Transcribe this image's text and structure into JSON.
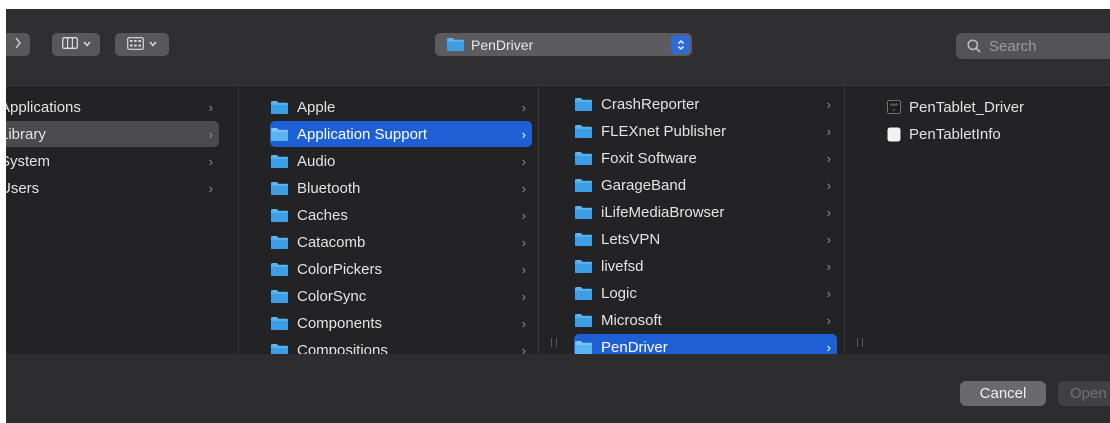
{
  "toolbar": {
    "forward_icon": "chevron-right-icon",
    "view_icon": "column-view-icon",
    "group_icon": "group-grid-icon",
    "path_popup_label": "PenDriver",
    "search_placeholder": "Search"
  },
  "columns": {
    "locations": [
      {
        "label": "Applications",
        "selected": false
      },
      {
        "label": "Library",
        "selected": true
      },
      {
        "label": "System",
        "selected": false
      },
      {
        "label": "Users",
        "selected": false
      }
    ],
    "library": [
      {
        "label": "Apple",
        "selected": false
      },
      {
        "label": "Application Support",
        "selected": true
      },
      {
        "label": "Audio",
        "selected": false
      },
      {
        "label": "Bluetooth",
        "selected": false
      },
      {
        "label": "Caches",
        "selected": false
      },
      {
        "label": "Catacomb",
        "selected": false
      },
      {
        "label": "ColorPickers",
        "selected": false
      },
      {
        "label": "ColorSync",
        "selected": false
      },
      {
        "label": "Components",
        "selected": false
      },
      {
        "label": "Compositions",
        "selected": false
      }
    ],
    "application_support": [
      {
        "label": "CrashReporter",
        "selected": false
      },
      {
        "label": "FLEXnet Publisher",
        "selected": false
      },
      {
        "label": "Foxit Software",
        "selected": false
      },
      {
        "label": "GarageBand",
        "selected": false
      },
      {
        "label": "iLifeMediaBrowser",
        "selected": false
      },
      {
        "label": "LetsVPN",
        "selected": false
      },
      {
        "label": "livefsd",
        "selected": false
      },
      {
        "label": "Logic",
        "selected": false
      },
      {
        "label": "Microsoft",
        "selected": false
      },
      {
        "label": "PenDriver",
        "selected": true
      }
    ],
    "pendriver": [
      {
        "label": "PenTablet_Driver",
        "icon": "executable-icon"
      },
      {
        "label": "PenTabletInfo",
        "icon": "document-icon"
      }
    ]
  },
  "footer": {
    "cancel_label": "Cancel",
    "open_label": "Open"
  },
  "colors": {
    "selection": "#1f5fd6",
    "folder": "#5ab4f0"
  }
}
